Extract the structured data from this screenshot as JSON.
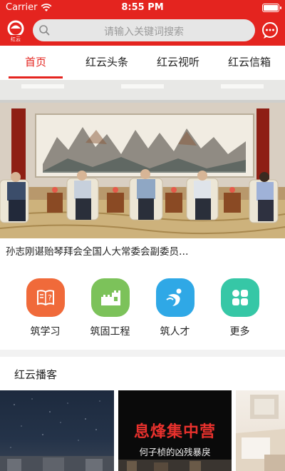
{
  "status": {
    "carrier": "Carrier",
    "time": "8:55 PM"
  },
  "header": {
    "logo_text": "红云",
    "search_placeholder": "请输入关键词搜索"
  },
  "tabs": [
    {
      "label": "首页",
      "active": true
    },
    {
      "label": "红云头条",
      "active": false
    },
    {
      "label": "红云视听",
      "active": false
    },
    {
      "label": "红云信箱",
      "active": false
    }
  ],
  "hero": {
    "caption": "孙志刚谌贻琴拜会全国人大常委会副委员…"
  },
  "features": [
    {
      "label": "筑学习",
      "icon": "book-question-icon",
      "color": "#f06a3a"
    },
    {
      "label": "筑固工程",
      "icon": "great-wall-icon",
      "color": "#7cc25a"
    },
    {
      "label": "筑人才",
      "icon": "person-icon",
      "color": "#2fa8e6"
    },
    {
      "label": "更多",
      "icon": "grid-icon",
      "color": "#36c7a6"
    }
  ],
  "podcast": {
    "title": "红云播客",
    "cards": [
      {
        "title": "",
        "subtitle": ""
      },
      {
        "title": "息烽集中营",
        "subtitle": "何子桢的凶残暴戾"
      },
      {
        "title": "",
        "subtitle": ""
      }
    ]
  }
}
